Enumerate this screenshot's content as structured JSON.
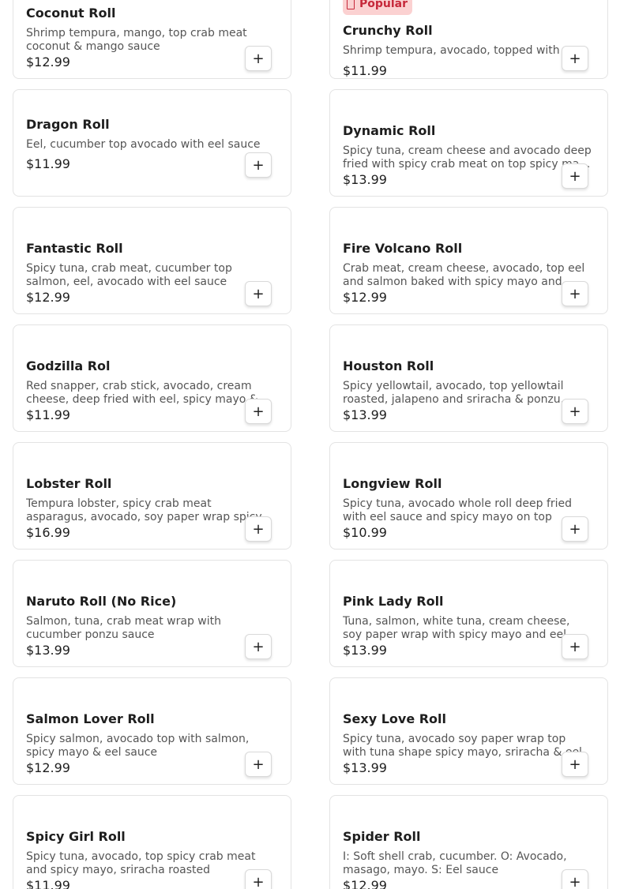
{
  "menu": {
    "add_label": "+",
    "items": [
      {
        "name": "Coconut Roll",
        "desc": "Shrimp tempura, mango, top crab meat coconut & mango sauce",
        "price": "$12.99"
      },
      {
        "name": "Crunchy Roll",
        "desc": "Shrimp tempura, avocado, topped with crunch…",
        "price": "$11.99",
        "badge": "Popular"
      },
      {
        "name": "Dragon Roll",
        "desc": "Eel, cucumber top avocado with eel sauce",
        "price": "$11.99"
      },
      {
        "name": "Dynamic Roll",
        "desc": "Spicy tuna, cream cheese and avocado deep fried with spicy crab meat on top spicy ma…",
        "price": "$13.99"
      },
      {
        "name": "Fantastic Roll",
        "desc": "Spicy tuna, crab meat, cucumber top salmon, eel, avocado with eel sauce",
        "price": "$12.99"
      },
      {
        "name": "Fire Volcano Roll",
        "desc": "Crab meat, cream cheese, avocado, top eel and salmon baked with spicy mayo and eel…",
        "price": "$12.99"
      },
      {
        "name": "Godzilla Rol",
        "desc": "Red snapper, crab stick, avocado, cream cheese, deep fried with eel, spicy mayo &…",
        "price": "$11.99"
      },
      {
        "name": "Houston Roll",
        "desc": "Spicy yellowtail, avocado, top yellowtail roasted, jalapeno and sriracha & ponzu…",
        "price": "$13.99"
      },
      {
        "name": "Lobster Roll",
        "desc": "Tempura lobster, spicy crab meat asparagus, avocado, soy paper wrap spicy mayo and e…",
        "price": "$16.99"
      },
      {
        "name": "Longview Roll",
        "desc": "Spicy tuna, avocado whole roll deep fried with eel sauce and spicy mayo on top",
        "price": "$10.99"
      },
      {
        "name": "Naruto Roll (No Rice)",
        "desc": "Salmon, tuna, crab meat wrap with cucumber ponzu sauce",
        "price": "$13.99"
      },
      {
        "name": "Pink Lady Roll",
        "desc": "Tuna, salmon, white tuna, cream cheese, soy paper wrap with spicy mayo and eel sauce",
        "price": "$13.99"
      },
      {
        "name": "Salmon Lover Roll",
        "desc": "Spicy salmon, avocado top with salmon, spicy mayo & eel sauce",
        "price": "$12.99"
      },
      {
        "name": "Sexy Love Roll",
        "desc": "Spicy tuna, avocado soy paper wrap top with tuna shape spicy mayo, sriracha & eel sauce",
        "price": "$13.99"
      },
      {
        "name": "Spicy Girl Roll",
        "desc": "Spicy tuna, avocado, top spicy crab meat and spicy mayo, sriracha roasted",
        "price": "$11.99"
      },
      {
        "name": "Spider Roll",
        "desc": "I: Soft shell crab, cucumber. O: Avocado, masago, mayo. S: Eel sauce",
        "price": "$12.99"
      }
    ]
  },
  "colors": {
    "badge_bg": "#fbd1d1",
    "badge_text": "#c6283a",
    "card_border": "#e3e3e3"
  }
}
